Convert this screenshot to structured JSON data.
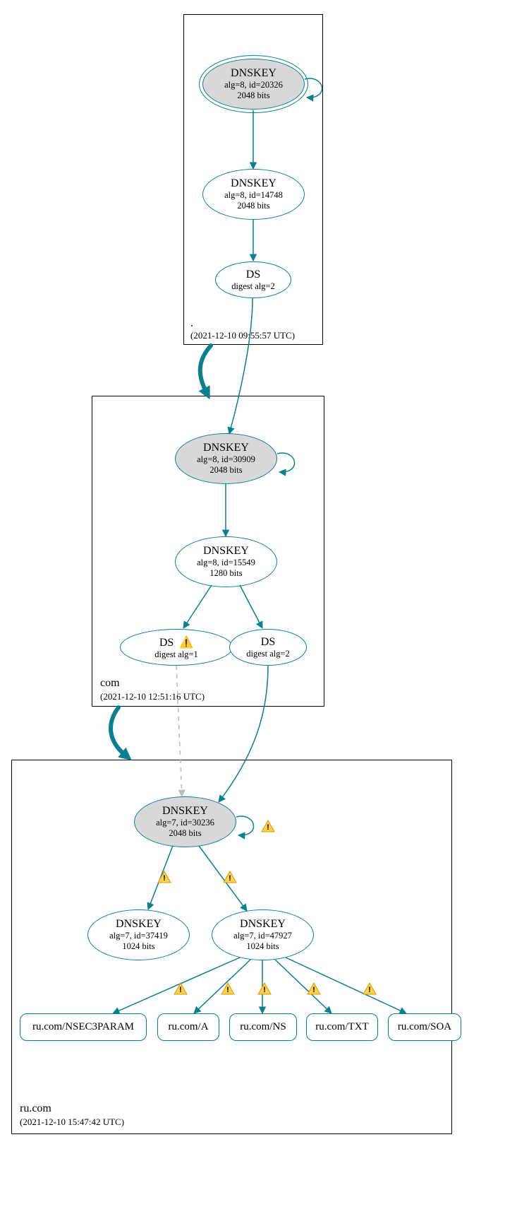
{
  "zones": {
    "root": {
      "name": ".",
      "timestamp": "(2021-12-10 09:55:57 UTC)"
    },
    "com": {
      "name": "com",
      "timestamp": "(2021-12-10 12:51:16 UTC)"
    },
    "rucom": {
      "name": "ru.com",
      "timestamp": "(2021-12-10 15:47:42 UTC)"
    }
  },
  "nodes": {
    "root_ksk": {
      "title": "DNSKEY",
      "sub1": "alg=8, id=20326",
      "sub2": "2048 bits"
    },
    "root_zsk": {
      "title": "DNSKEY",
      "sub1": "alg=8, id=14748",
      "sub2": "2048 bits"
    },
    "root_ds": {
      "title": "DS",
      "sub1": "digest alg=2"
    },
    "com_ksk": {
      "title": "DNSKEY",
      "sub1": "alg=8, id=30909",
      "sub2": "2048 bits"
    },
    "com_zsk": {
      "title": "DNSKEY",
      "sub1": "alg=8, id=15549",
      "sub2": "1280 bits"
    },
    "com_ds1": {
      "title": "DS",
      "sub1": "digest alg=1"
    },
    "com_ds2": {
      "title": "DS",
      "sub1": "digest alg=2"
    },
    "rc_ksk": {
      "title": "DNSKEY",
      "sub1": "alg=7, id=30236",
      "sub2": "2048 bits"
    },
    "rc_zsk1": {
      "title": "DNSKEY",
      "sub1": "alg=7, id=37419",
      "sub2": "1024 bits"
    },
    "rc_zsk2": {
      "title": "DNSKEY",
      "sub1": "alg=7, id=47927",
      "sub2": "1024 bits"
    }
  },
  "rr": {
    "nsec3": "ru.com/NSEC3PARAM",
    "a": "ru.com/A",
    "ns": "ru.com/NS",
    "txt": "ru.com/TXT",
    "soa": "ru.com/SOA"
  },
  "warn_glyph": "!"
}
